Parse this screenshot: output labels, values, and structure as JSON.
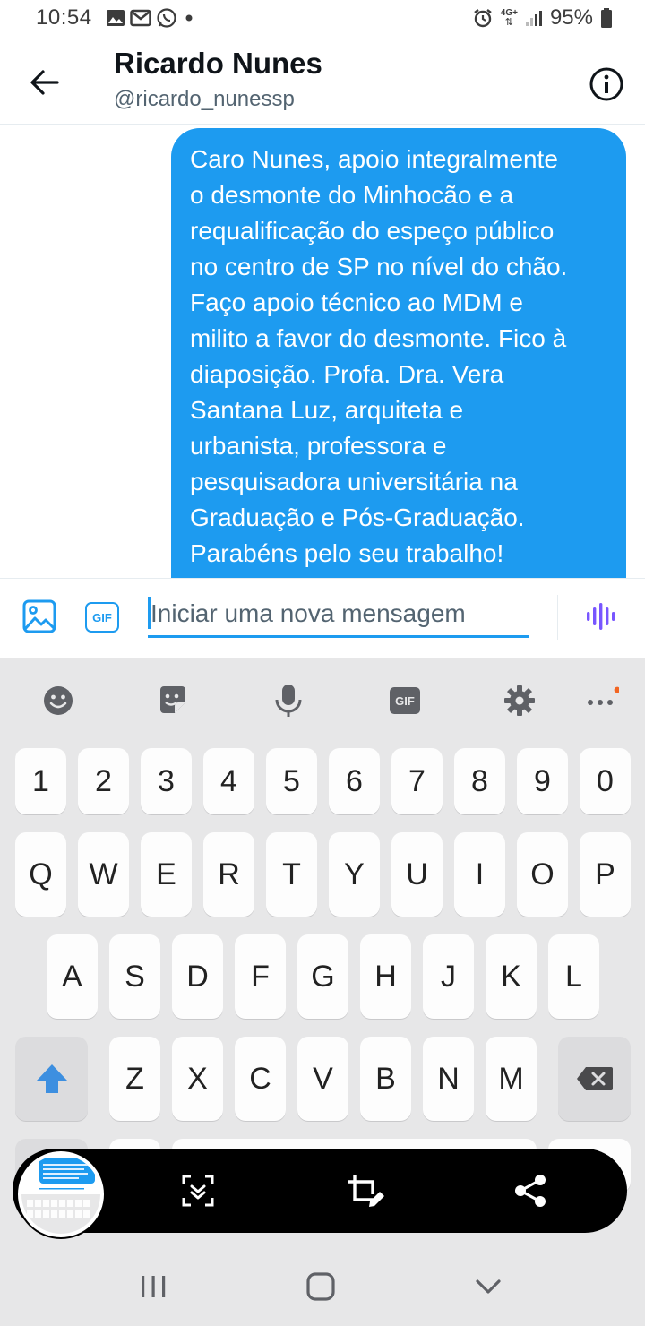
{
  "status_bar": {
    "time": "10:54",
    "notification_icons": [
      "image-icon",
      "gmail-icon",
      "whatsapp-icon",
      "dot-icon"
    ],
    "network": "4G+",
    "battery": "95%"
  },
  "header": {
    "name": "Ricardo Nunes",
    "handle": "@ricardo_nunessp"
  },
  "message": {
    "lines": [
      "Caro Nunes, apoio integralmente",
      "o desmonte do Minhocão e a",
      "requalificação do espeço público",
      "no centro de SP no nível do chão.",
      "Faço apoio técnico ao MDM e",
      "milito a favor do desmonte. Fico à",
      "diaposição. Profa. Dra. Vera",
      "Santana Luz, arquiteta e",
      "urbanista, professora e",
      "pesquisadora universitária na",
      "Graduação e Pós-Graduação.",
      "Parabéns pelo seu trabalho!"
    ]
  },
  "composer": {
    "placeholder": "Iniciar uma nova mensagem",
    "gif_label": "GIF"
  },
  "keyboard": {
    "toolbar_gif": "GIF",
    "row_numbers": [
      "1",
      "2",
      "3",
      "4",
      "5",
      "6",
      "7",
      "8",
      "9",
      "0"
    ],
    "row_1": [
      "Q",
      "W",
      "E",
      "R",
      "T",
      "Y",
      "U",
      "I",
      "O",
      "P"
    ],
    "row_2": [
      "A",
      "S",
      "D",
      "F",
      "G",
      "H",
      "J",
      "K",
      "L"
    ],
    "row_3": [
      "Z",
      "X",
      "C",
      "V",
      "B",
      "N",
      "M"
    ]
  },
  "colors": {
    "accent": "#1d9bf0",
    "voice_purple": "#7856ff",
    "keyboard_bg": "#e7e7e8"
  }
}
